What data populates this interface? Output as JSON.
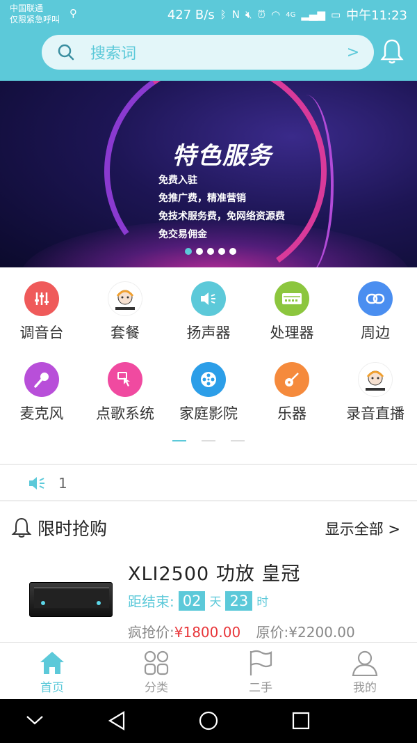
{
  "status_bar": {
    "carrier_line1": "中国联通",
    "carrier_line2": "仅限紧急呼叫",
    "net_speed": "427 B/s",
    "signal_label": "4G",
    "time": "中午11:23"
  },
  "search": {
    "placeholder": "搜索词",
    "chevron": ">"
  },
  "banner": {
    "title": "特色服务",
    "lines": [
      "免费入驻",
      "免推广费，精准营销",
      "免技术服务费，免网络资源费",
      "免交易佣金"
    ],
    "page_count": 5,
    "active_page": 1
  },
  "categories": [
    {
      "label": "调音台",
      "icon": "mixer-icon",
      "color": "#ef5a5a"
    },
    {
      "label": "套餐",
      "icon": "mascot-icon",
      "color": "#ffffff"
    },
    {
      "label": "扬声器",
      "icon": "speaker-icon",
      "color": "#5cc9d9"
    },
    {
      "label": "处理器",
      "icon": "processor-icon",
      "color": "#8cc63e"
    },
    {
      "label": "周边",
      "icon": "link-icon",
      "color": "#4a8ef0"
    },
    {
      "label": "麦克风",
      "icon": "microphone-icon",
      "color": "#b84fd9"
    },
    {
      "label": "点歌系统",
      "icon": "touch-icon",
      "color": "#f04aa0"
    },
    {
      "label": "家庭影院",
      "icon": "film-reel-icon",
      "color": "#2c9ee8"
    },
    {
      "label": "乐器",
      "icon": "guitar-icon",
      "color": "#f58a3c"
    },
    {
      "label": "录音直播",
      "icon": "mascot-icon",
      "color": "#ffffff"
    }
  ],
  "category_pages": {
    "count": 3,
    "active": 1
  },
  "notice": {
    "count": "1"
  },
  "flash_sale": {
    "title": "限时抢购",
    "show_all": "显示全部 >"
  },
  "product": {
    "name": "XLI2500  功放  皇冠",
    "countdown_label": "距结束:",
    "days": "02",
    "days_unit": "天",
    "hours": "23",
    "hours_unit": "时",
    "sale_label": "疯抢价:",
    "sale_price": "¥1800.00",
    "orig_label": "原价:",
    "orig_price": "¥2200.00"
  },
  "tabs": [
    {
      "label": "首页",
      "icon": "home-icon",
      "active": true
    },
    {
      "label": "分类",
      "icon": "grid-icon",
      "active": false
    },
    {
      "label": "二手",
      "icon": "flag-icon",
      "active": false
    },
    {
      "label": "我的",
      "icon": "user-icon",
      "active": false
    }
  ],
  "colors": {
    "accent": "#5cc9d9",
    "price_red": "#e8363a"
  }
}
